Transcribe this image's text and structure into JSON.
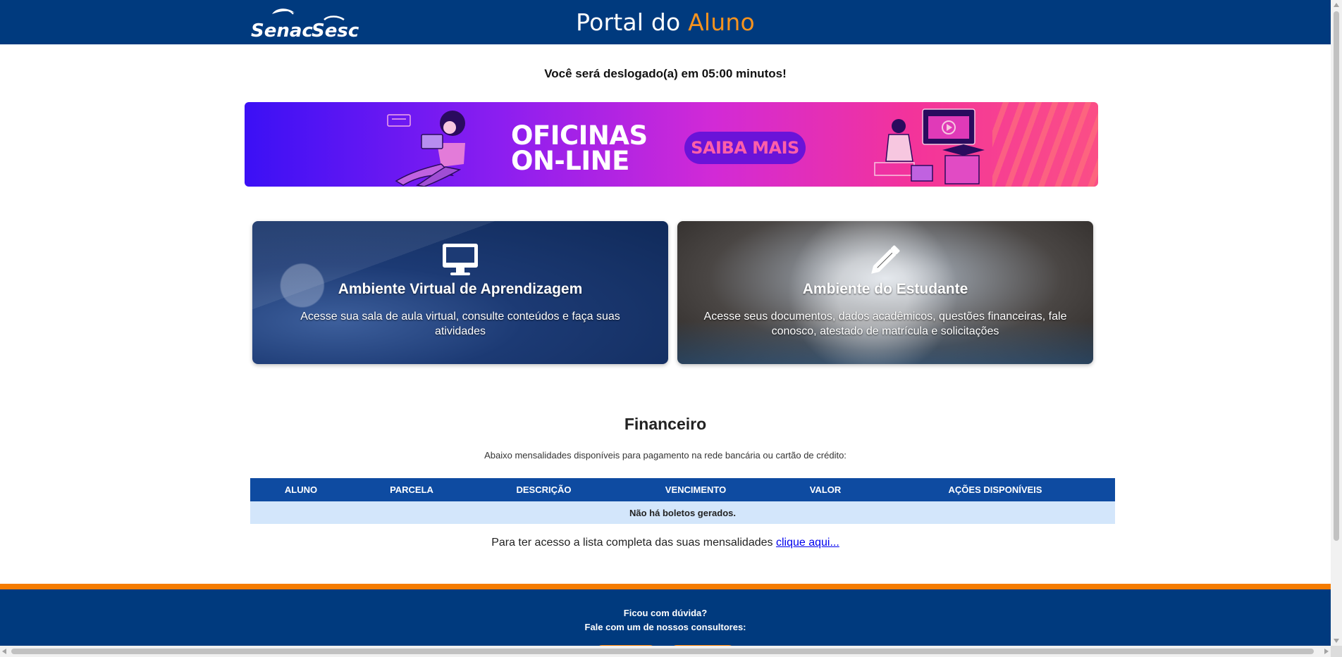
{
  "header": {
    "logos": [
      "Senac",
      "Sesc"
    ],
    "title_prefix": "Portal do",
    "title_accent": "Aluno",
    "accent_color": "#f7931e",
    "bg_color": "#003a7e"
  },
  "session": {
    "logout_message": "Você será deslogado(a) em 05:00 minutos!"
  },
  "banner": {
    "title_line1": "OFICINAS",
    "title_line2": "ON-LINE",
    "cta_label": "SAIBA MAIS"
  },
  "cards": [
    {
      "icon": "monitor-icon",
      "title": "Ambiente Virtual de Aprendizagem",
      "description": "Acesse sua sala de aula virtual, consulte conteúdos e faça suas atividades"
    },
    {
      "icon": "pencil-icon",
      "title": "Ambiente do Estudante",
      "description": "Acesse seus documentos, dados acadêmicos, questões financeiras, fale conosco, atestado de matrícula e solicitações"
    }
  ],
  "financeiro": {
    "title": "Financeiro",
    "subtitle": "Abaixo mensalidades disponíveis para pagamento na rede bancária ou cartão de crédito:",
    "columns": [
      "ALUNO",
      "PARCELA",
      "DESCRIÇÃO",
      "VENCIMENTO",
      "VALOR",
      "AÇÕES DISPONÍVEIS"
    ],
    "empty_message": "Não há boletos gerados.",
    "more_text": "Para ter acesso a lista completa das suas mensalidades",
    "more_link": "clique aqui..."
  },
  "footer": {
    "question": "Ficou com dúvida?",
    "contact": "Fale com um de nossos consultores:",
    "stripe_color": "#f57c00"
  }
}
